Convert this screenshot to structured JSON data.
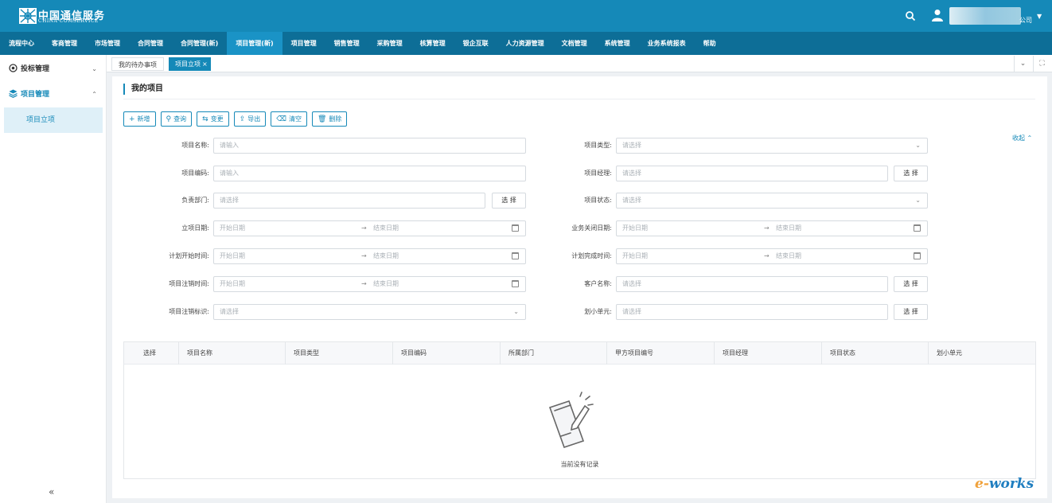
{
  "header": {
    "brand_cn": "中国通信服务",
    "brand_en": "CHINA COMSERVICE",
    "user_suffix": "公司"
  },
  "nav": {
    "items": [
      "流程中心",
      "客商管理",
      "市场管理",
      "合同管理",
      "合同管理(新)",
      "项目管理(新)",
      "项目管理",
      "销售管理",
      "采购管理",
      "核算管理",
      "银企互联",
      "人力资源管理",
      "文档管理",
      "系统管理",
      "业务系统报表",
      "帮助"
    ],
    "active_index": 5
  },
  "sidebar": {
    "groups": [
      {
        "label": "投标管理",
        "chevron": "⌄"
      },
      {
        "label": "项目管理",
        "chevron": "⌃"
      }
    ],
    "sub_item": "项目立项",
    "collapse": "«"
  },
  "tabs": {
    "todo": "我的待办事项",
    "project": "项目立项",
    "close": "×"
  },
  "page": {
    "title": "我的项目",
    "collapse_link": "收起"
  },
  "toolbar": {
    "add": "新增",
    "query": "查询",
    "change": "变更",
    "export": "导出",
    "clear": "清空",
    "delete": "删除"
  },
  "form": {
    "name_label": "项目名称:",
    "name_ph": "请输入",
    "type_label": "项目类型:",
    "type_ph": "请选择",
    "code_label": "项目编码:",
    "code_ph": "请输入",
    "manager_label": "项目经理:",
    "manager_ph": "请选择",
    "dept_label": "负责部门:",
    "dept_ph": "请选择",
    "status_label": "项目状态:",
    "status_ph": "请选择",
    "setup_date_label": "立项日期:",
    "close_date_label": "业务关闭日期:",
    "plan_start_label": "计划开始时间:",
    "plan_end_label": "计划完成时间:",
    "cancel_time_label": "项目注销时间:",
    "customer_label": "客户名称:",
    "customer_ph": "请选择",
    "cancel_flag_label": "项目注销标识:",
    "cancel_flag_ph": "请选择",
    "unit_label": "划小单元:",
    "unit_ph": "请选择",
    "start_ph": "开始日期",
    "end_ph": "结束日期",
    "range_arrow": "→",
    "select_btn": "选 择"
  },
  "table": {
    "columns": [
      "选择",
      "项目名称",
      "项目类型",
      "项目编码",
      "所属部门",
      "甲方项目编号",
      "项目经理",
      "项目状态",
      "划小单元"
    ],
    "empty_text": "当前没有记录"
  },
  "watermark": {
    "part1": "e-",
    "part2": "works"
  },
  "colors": {
    "brand": "#1589b8",
    "nav": "#0d6e97"
  }
}
